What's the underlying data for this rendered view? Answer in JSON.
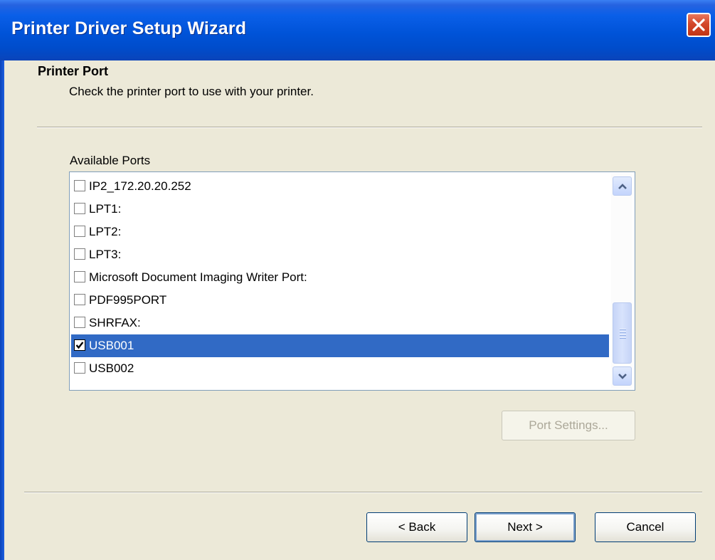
{
  "window": {
    "title": "Printer Driver Setup Wizard"
  },
  "header": {
    "title": "Printer Port",
    "subtitle": "Check the printer port to use with your printer."
  },
  "ports": {
    "label": "Available Ports",
    "items": [
      {
        "label": "IP2_172.20.20.252",
        "checked": false,
        "selected": false
      },
      {
        "label": "LPT1:",
        "checked": false,
        "selected": false
      },
      {
        "label": "LPT2:",
        "checked": false,
        "selected": false
      },
      {
        "label": "LPT3:",
        "checked": false,
        "selected": false
      },
      {
        "label": "Microsoft Document Imaging Writer Port:",
        "checked": false,
        "selected": false
      },
      {
        "label": "PDF995PORT",
        "checked": false,
        "selected": false
      },
      {
        "label": "SHRFAX:",
        "checked": false,
        "selected": false
      },
      {
        "label": "USB001",
        "checked": true,
        "selected": true
      },
      {
        "label": "USB002",
        "checked": false,
        "selected": false
      }
    ]
  },
  "buttons": {
    "port_settings": "Port Settings...",
    "back": "< Back",
    "next": "Next >",
    "cancel": "Cancel"
  },
  "icons": {
    "close": "close-icon",
    "check": "checkmark-icon",
    "scroll_up": "chevron-up-icon",
    "scroll_down": "chevron-down-icon"
  },
  "colors": {
    "titlebar": "#0053D8",
    "selection": "#316AC5",
    "dialog_bg": "#ECE9D8",
    "close": "#D3472A"
  }
}
